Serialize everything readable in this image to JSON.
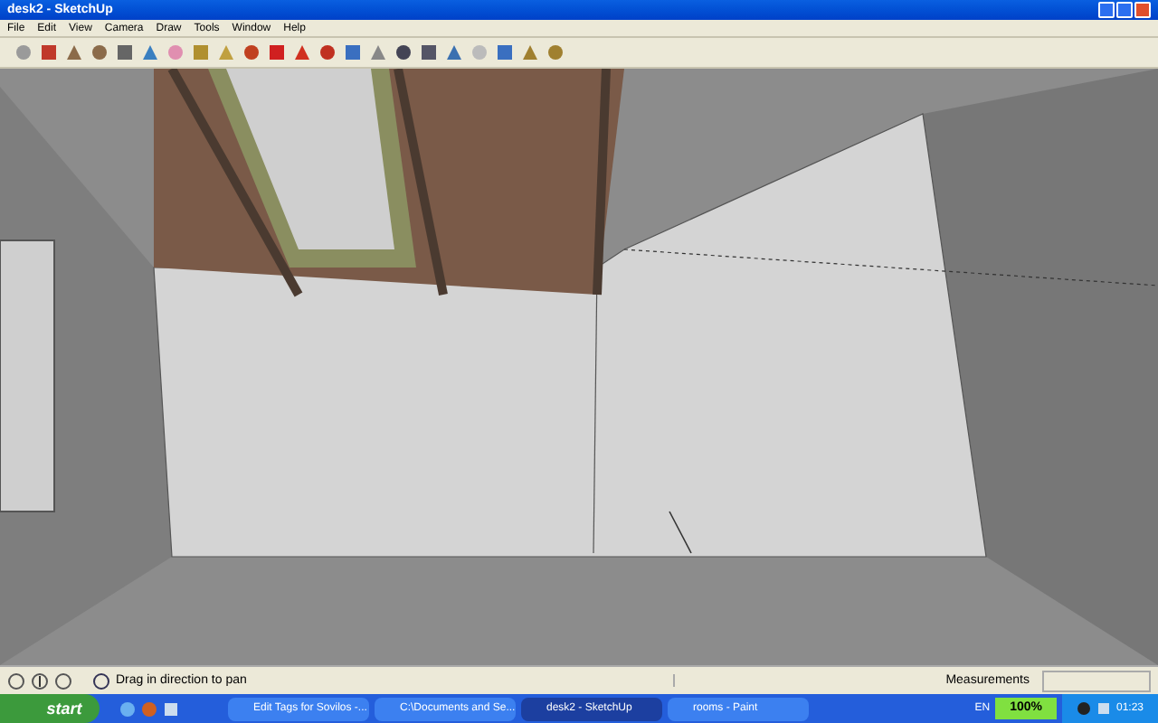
{
  "window": {
    "title": "desk2 - SketchUp"
  },
  "menu": [
    "File",
    "Edit",
    "View",
    "Camera",
    "Draw",
    "Tools",
    "Window",
    "Help"
  ],
  "status_bar": {
    "hint": "Drag in direction to pan",
    "measurements_label": "Measurements"
  },
  "taskbar": {
    "start": "start",
    "tasks": [
      {
        "label": "Edit Tags for Sovilos -...",
        "selected": false
      },
      {
        "label": "C:\\Documents and Se...",
        "selected": false
      },
      {
        "label": "desk2 - SketchUp",
        "selected": true
      },
      {
        "label": "rooms - Paint",
        "selected": false
      }
    ],
    "language": "EN",
    "zoom": "100%",
    "clock": "01:23"
  }
}
